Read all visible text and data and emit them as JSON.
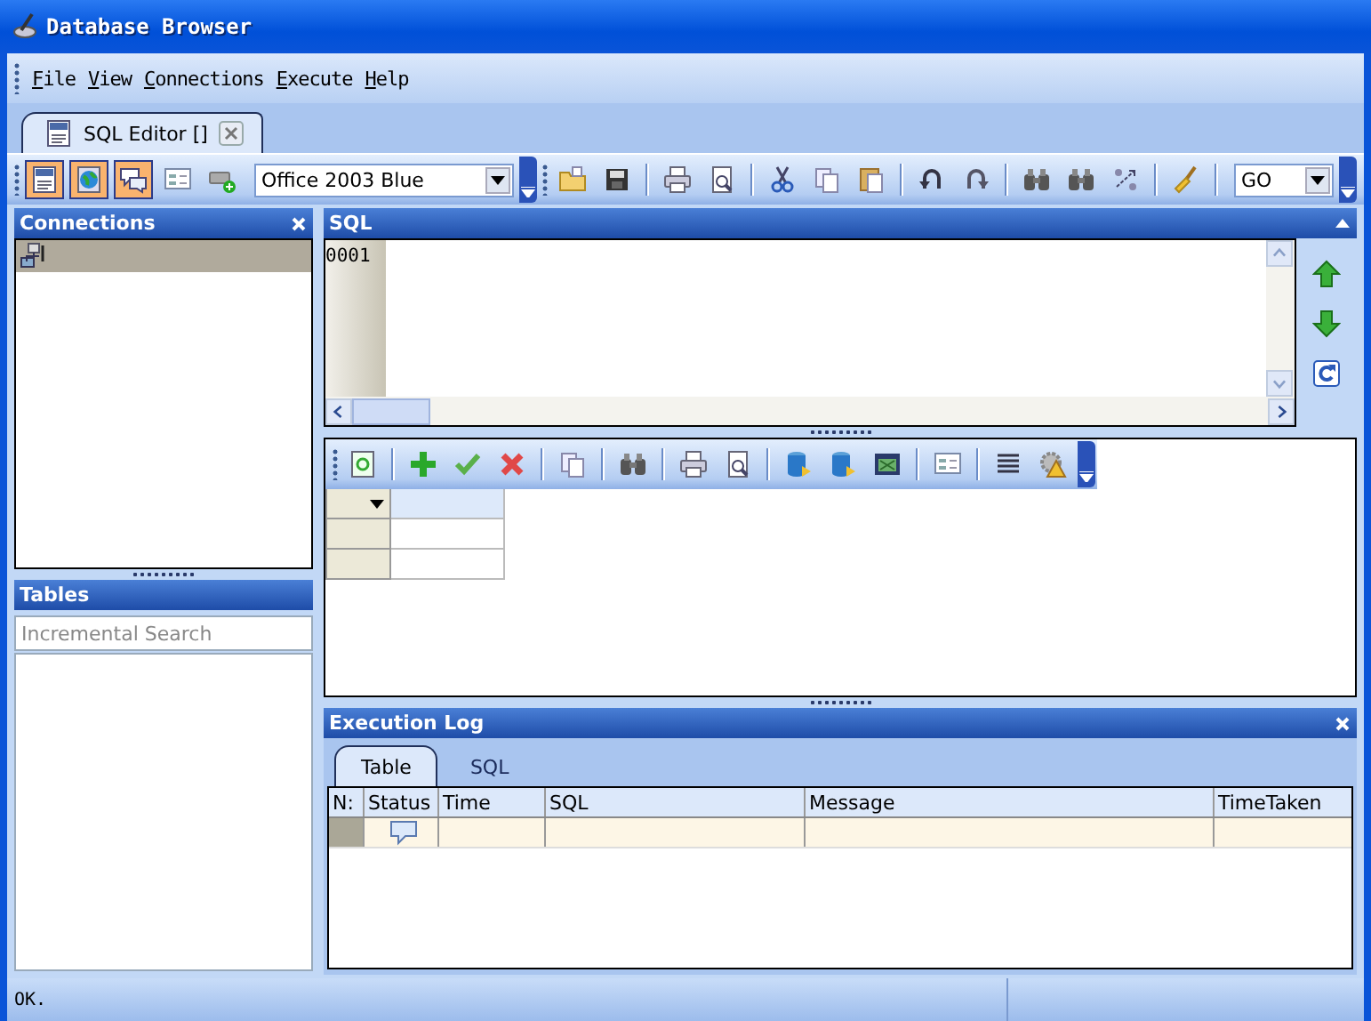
{
  "window": {
    "title": "Database Browser"
  },
  "menu": [
    {
      "label": "File"
    },
    {
      "label": "View"
    },
    {
      "label": "Connections"
    },
    {
      "label": "Execute"
    },
    {
      "label": "Help"
    }
  ],
  "document_tabs": [
    {
      "label": "SQL Editor []",
      "selected": true
    }
  ],
  "main_toolbar": [
    {
      "kind": "button",
      "pressed": true
    },
    {
      "kind": "button",
      "pressed": true
    },
    {
      "kind": "button",
      "pressed": true
    },
    {
      "kind": "button",
      "pressed": false
    },
    {
      "kind": "button",
      "pressed": false
    },
    {
      "kind": "combo",
      "value": "Office 2003 Blue"
    },
    {
      "kind": "overflow"
    },
    {
      "kind": "grip"
    },
    {
      "kind": "button",
      "pressed": false
    },
    {
      "kind": "button",
      "pressed": false
    },
    {
      "kind": "separator"
    },
    {
      "kind": "button",
      "pressed": false
    },
    {
      "kind": "button",
      "pressed": false
    },
    {
      "kind": "separator"
    },
    {
      "kind": "button",
      "pressed": false
    },
    {
      "kind": "button",
      "pressed": false
    },
    {
      "kind": "button",
      "pressed": false
    },
    {
      "kind": "separator"
    },
    {
      "kind": "button",
      "pressed": false
    },
    {
      "kind": "button",
      "pressed": false
    },
    {
      "kind": "separator"
    },
    {
      "kind": "button",
      "pressed": false
    },
    {
      "kind": "button",
      "pressed": false
    },
    {
      "kind": "button",
      "pressed": false
    },
    {
      "kind": "separator"
    },
    {
      "kind": "button",
      "pressed": false
    },
    {
      "kind": "separator"
    },
    {
      "kind": "combo",
      "value": "GO"
    },
    {
      "kind": "overflow"
    }
  ],
  "connections": {
    "title": "Connections",
    "items": [
      {
        "selected": true
      }
    ]
  },
  "tables": {
    "title": "Tables",
    "search": {
      "placeholder": "Incremental Search"
    }
  },
  "sql_editor": {
    "title": "SQL",
    "line_numbers": [
      "0001"
    ]
  },
  "grid_toolbar": [
    {
      "kind": "button"
    },
    {
      "kind": "separator"
    },
    {
      "kind": "button"
    },
    {
      "kind": "button"
    },
    {
      "kind": "button"
    },
    {
      "kind": "separator"
    },
    {
      "kind": "button"
    },
    {
      "kind": "separator"
    },
    {
      "kind": "button"
    },
    {
      "kind": "separator"
    },
    {
      "kind": "button"
    },
    {
      "kind": "button"
    },
    {
      "kind": "separator"
    },
    {
      "kind": "button"
    },
    {
      "kind": "button"
    },
    {
      "kind": "button"
    },
    {
      "kind": "separator"
    },
    {
      "kind": "button"
    },
    {
      "kind": "separator"
    },
    {
      "kind": "button"
    },
    {
      "kind": "button"
    },
    {
      "kind": "overflow"
    }
  ],
  "execution_log": {
    "title": "Execution Log",
    "tabs": [
      {
        "label": "Table",
        "selected": true
      },
      {
        "label": "SQL",
        "selected": false
      }
    ],
    "columns": [
      "N:",
      "Status",
      "Time",
      "SQL",
      "Message",
      "TimeTaken"
    ],
    "rows": [
      {
        "kind": "message"
      }
    ]
  },
  "status_bar": {
    "text": "OK."
  }
}
